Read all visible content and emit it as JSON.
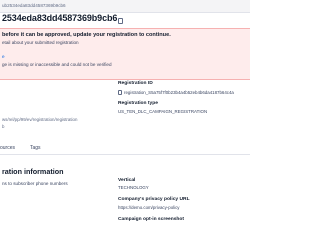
{
  "breadcrumb": {
    "text": "ub2534eda83dd4587369b9cb6"
  },
  "header": {
    "title": "2534eda83dd4587369b9cb6"
  },
  "alert": {
    "title": "before it can be approved, update your registration to continue.",
    "subtitle": "etail about your submitted registration",
    "link": "e",
    "detail": "ge is missing or inaccessible and could not be verified"
  },
  "details": {
    "registration_id_label": "Registration ID",
    "registration_id_value": "registration_S5a75f7f0b23b4a4b52eb4b6da4187b64c4a",
    "registration_type_label": "Registration type",
    "registration_type_value": "US_TEN_DLC_CAMPAIGN_REGISTRATION",
    "left_url": "ws/rel/pp/99/ev/registration/registration",
    "left_url2": "b"
  },
  "tabs": [
    {
      "label": "ources"
    },
    {
      "label": "Tags"
    }
  ],
  "section": {
    "title": "ration information",
    "subtitle": "ns to subscriber phone numbers"
  },
  "info": {
    "vertical_label": "Vertical",
    "vertical_value": "TECHNOLOGY",
    "privacy_label": "Company's privacy policy URL",
    "privacy_value": "https://demo.com/privacy-policy",
    "optin_label": "Campaign opt-in screenshot"
  },
  "colors": {
    "alert_bg": "#feecec",
    "alert_border": "#f6b1b1",
    "link": "#0263e0"
  }
}
